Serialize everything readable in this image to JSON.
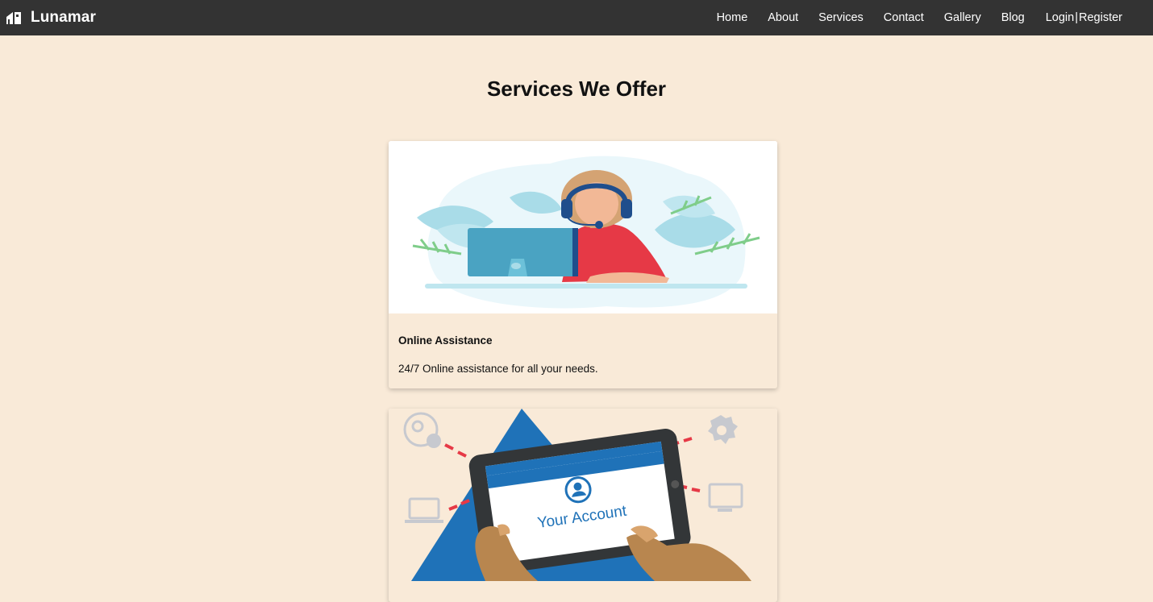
{
  "brand": {
    "name": "Lunamar",
    "icon": "home-logo-icon"
  },
  "nav": {
    "links": [
      "Home",
      "About",
      "Services",
      "Contact",
      "Gallery",
      "Blog"
    ],
    "login": "Login",
    "separator": "|",
    "register": "Register"
  },
  "page": {
    "title": "Services We Offer"
  },
  "services": [
    {
      "title": "Online Assistance",
      "text": "24/7 Online assistance for all your needs.",
      "illustration": "support-agent-illustration"
    },
    {
      "illustration": "your-account-tablet-illustration",
      "illustration_text": "Your Account"
    }
  ],
  "colors": {
    "navbar": "#333333",
    "background": "#f9ead8",
    "accent_blue": "#1f72b8",
    "accent_red": "#e63946"
  }
}
